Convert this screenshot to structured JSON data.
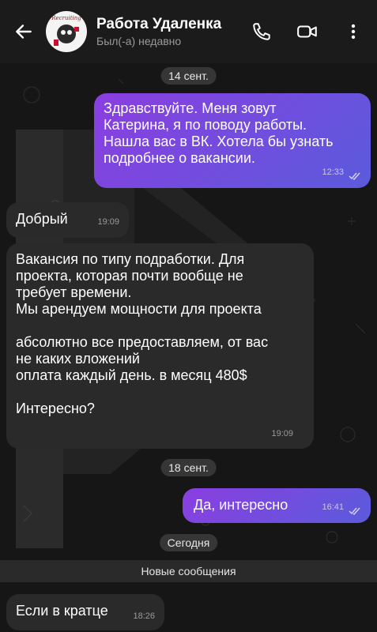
{
  "header": {
    "title": "Работа Удаленка",
    "status": "Был(-а) недавно",
    "avatar_text": "Recruiting",
    "icons": [
      "back-arrow-icon",
      "phone-icon",
      "video-icon",
      "more-vertical-icon"
    ]
  },
  "dates": {
    "first": "14 сент.",
    "second": "18 сент.",
    "third": "Сегодня"
  },
  "messages": [
    {
      "dir": "out",
      "text": "Здравствуйте. Меня зовут\nКатерина, я по поводу работы.\nНашла вас в ВК. Хотела бы узнать\nподробнее о вакансии.",
      "time": "12:33"
    },
    {
      "dir": "in",
      "text": "Добрый",
      "time": "19:09"
    },
    {
      "dir": "in",
      "text": "Вакансия по типу подработки. Для\nпроекта, которая почти вообще не\nтребует времени.\nМы арендуем мощности для проекта\n\nабсолютно все предоставляем, от вас\nне каких вложений\nоплата каждый день. в месяц 480$\n\nИнтересно?",
      "time": "19:09"
    },
    {
      "dir": "out",
      "text": "Да, интересно",
      "time": "16:41"
    },
    {
      "dir": "in",
      "text": "Если в кратце",
      "time": "18:26"
    }
  ],
  "new_messages_label": "Новые сообщения",
  "colors": {
    "outgoing_start": "#8a3ee0",
    "outgoing_end": "#5b5bdc",
    "incoming": "#2a2a2a",
    "background": "#161616"
  }
}
